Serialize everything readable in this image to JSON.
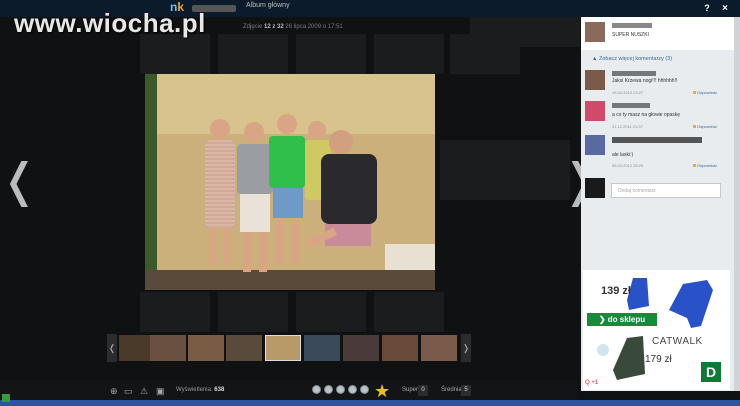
{
  "brand": {
    "watermark": "www.wiocha.pl",
    "app_logo_prefix": "n",
    "app_logo_suffix": "k"
  },
  "header": {
    "album_title": "Album główny",
    "help_label": "?",
    "close_label": "×"
  },
  "photo_info": {
    "prefix": "Zdjęcie",
    "current": "12 z 32",
    "date": "26 lipca 2009 o 17:51"
  },
  "nav": {
    "prev": "❬",
    "next": "❭"
  },
  "panel": {
    "top_comment": {
      "text": "SUPER NUSZKI"
    },
    "show_all": "Zobacz więcej komentarzy",
    "show_all_count": "(3)",
    "comments": [
      {
        "text": "Jaksi Krzewa nogi!!! hhhhhh!!",
        "date": "15.04.2010 23:27",
        "reply": "Odpowiedz"
      },
      {
        "text": "a co ty masz na głowie opaskę",
        "date": "31.12.2011 21:37",
        "reply": "Odpowiedz"
      },
      {
        "text": "ale laski:)",
        "date": "08.04.2012 18:29",
        "reply": "Odpowiedz"
      }
    ],
    "add_comment_placeholder": "Dodaj komentarz"
  },
  "ad": {
    "price1": "139 zł",
    "shop_button": "❯ do sklepu",
    "brand": "CATWALK",
    "price2": "179 zł",
    "logo": "D",
    "tag": "Q +1"
  },
  "thumbs": {
    "prev": "❬",
    "next": "❭"
  },
  "bottom": {
    "icons": [
      "zoom-icon",
      "fullscreen-icon",
      "warning-icon",
      "share-icon"
    ],
    "views_label": "Wyświetlenia:",
    "views_value": "638",
    "super_label": "Super",
    "super_count": "0",
    "avg_label": "Średnia:",
    "avg_value": "5"
  },
  "colors": {
    "accent": "#2c55a0",
    "topbar": "#0b1b2b",
    "green_button": "#1a8a3a"
  }
}
